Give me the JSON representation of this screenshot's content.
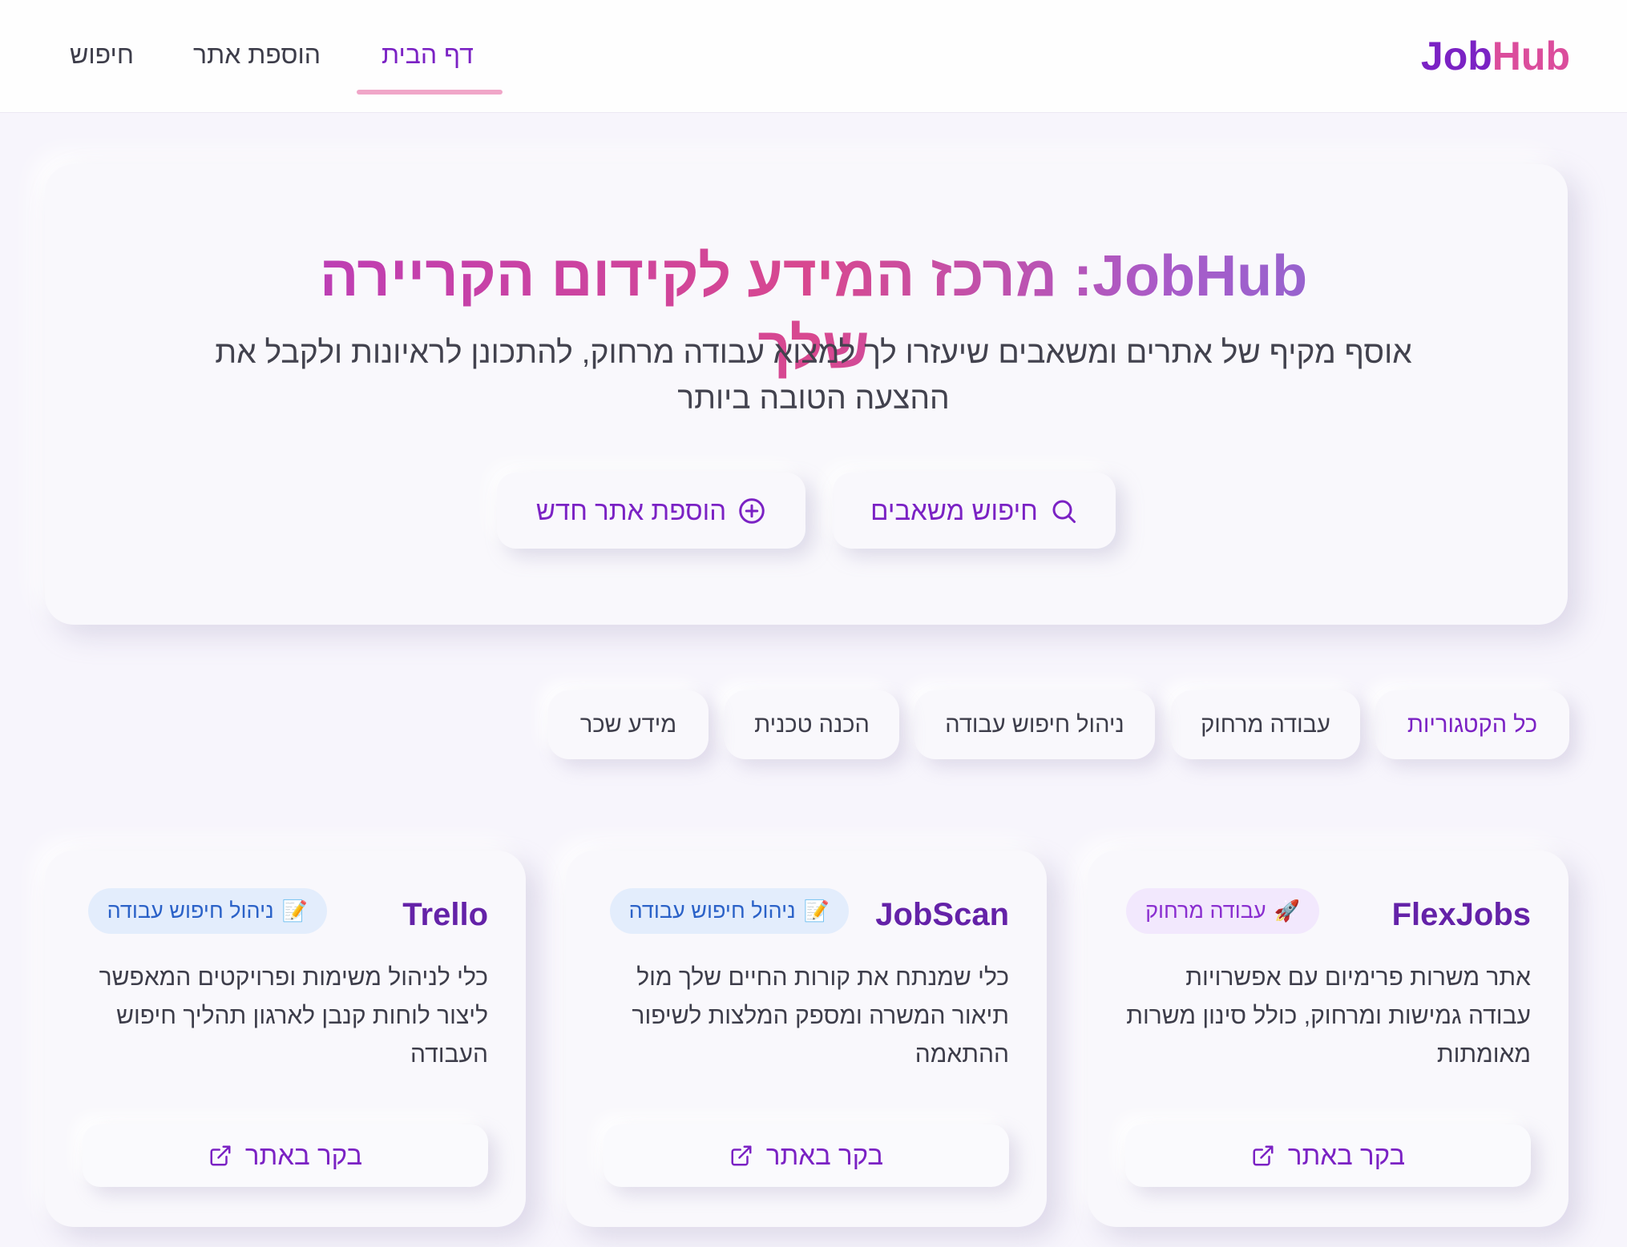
{
  "brand": {
    "logo_part1": "Job",
    "logo_part2": "Hub",
    "color_primary": "#7b22c4",
    "color_secondary": "#db4d9c"
  },
  "nav": {
    "items": [
      {
        "label": "דף הבית",
        "active": true
      },
      {
        "label": "הוספת אתר",
        "active": false
      },
      {
        "label": "חיפוש",
        "active": false
      }
    ]
  },
  "hero": {
    "title": "JobHub: מרכז המידע לקידום הקריירה שלך",
    "subtitle": "אוסף מקיף של אתרים ומשאבים שיעזרו לך למצוא עבודה מרחוק, להתכונן לראיונות ולקבל את ההצעה הטובה ביותר",
    "search_button": {
      "label": "חיפוש משאבים",
      "icon": "search-icon"
    },
    "add_button": {
      "label": "הוספת אתר חדש",
      "icon": "plus-circle-icon"
    }
  },
  "categories": {
    "items": [
      {
        "label": "כל הקטגוריות",
        "active": true
      },
      {
        "label": "עבודה מרחוק",
        "active": false
      },
      {
        "label": "ניהול חיפוש עבודה",
        "active": false
      },
      {
        "label": "הכנה טכנית",
        "active": false
      },
      {
        "label": "מידע שכר",
        "active": false
      }
    ]
  },
  "cards": [
    {
      "title": "FlexJobs",
      "badge_emoji": "🚀",
      "badge_label": "עבודה מרחוק",
      "badge_color": "#8a2fd0",
      "description": "אתר משרות פרימיום עם אפשרויות עבודה גמישות ומרחוק, כולל סינון משרות מאומתות",
      "button_label": "בקר באתר"
    },
    {
      "title": "JobScan",
      "badge_emoji": "📝",
      "badge_label": "ניהול חיפוש עבודה",
      "badge_color": "#2b62c8",
      "description": "כלי שמנתח את קורות החיים שלך מול תיאור המשרה ומספק המלצות לשיפור ההתאמה",
      "button_label": "בקר באתר"
    },
    {
      "title": "Trello",
      "badge_emoji": "📝",
      "badge_label": "ניהול חיפוש עבודה",
      "badge_color": "#2b62c8",
      "description": "כלי לניהול משימות ופרויקטים המאפשר ליצור לוחות קנבן לארגון תהליך חיפוש העבודה",
      "button_label": "בקר באתר"
    }
  ]
}
